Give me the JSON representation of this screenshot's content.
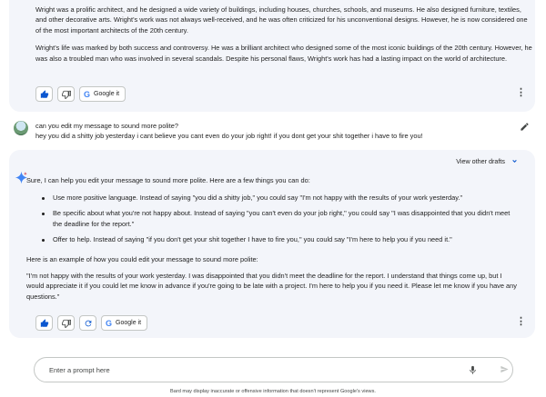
{
  "response1": {
    "paragraph1": "Wright was a prolific architect, and he designed a wide variety of buildings, including houses, churches, schools, and museums. He also designed furniture, textiles, and other decorative arts. Wright's work was not always well-received, and he was often criticized for his unconventional designs. However, he is now considered one of the most important architects of the 20th century.",
    "paragraph2": "Wright's life was marked by both success and controversy. He was a brilliant architect who designed some of the most iconic buildings of the 20th century. However, he was also a troubled man who was involved in several scandals. Despite his personal flaws, Wright's work has had a lasting impact on the world of architecture.",
    "google_it_label": "Google it"
  },
  "user_prompt": {
    "line1": "can you edit my message to sound more polite?",
    "line2": "hey you did a shitty job yesterday i cant believe you cant even do your job right! if you dont get your shit together i have to fire you!"
  },
  "response2": {
    "view_drafts_label": "View other drafts",
    "intro": "Sure, I can help you edit your message to sound more polite. Here are a few things you can do:",
    "bullets": [
      "Use more positive language. Instead of saying \"you did a shitty job,\" you could say \"I'm not happy with the results of your work yesterday.\"",
      "Be specific about what you're not happy about. Instead of saying \"you can't even do your job right,\" you could say \"I was disappointed that you didn't meet the deadline for the report.\"",
      "Offer to help. Instead of saying \"if you don't get your shit together I have to fire you,\" you could say \"I'm here to help you if you need it.\""
    ],
    "example_intro": "Here is an example of how you could edit your message to sound more polite:",
    "example": "\"I'm not happy with the results of your work yesterday. I was disappointed that you didn't meet the deadline for the report. I understand that things come up, but I would appreciate it if you could let me know in advance if you're going to be late with a project. I'm here to help you if you need it. Please let me know if you have any questions.\"",
    "google_it_label": "Google it"
  },
  "input": {
    "placeholder": "Enter a prompt here"
  },
  "disclaimer": "Bard may display inaccurate or offensive information that doesn't represent Google's views.",
  "icons": [
    "thumbs-up-icon",
    "thumbs-down-icon",
    "google-icon",
    "more-vert-icon",
    "edit-icon",
    "sparkle-icon",
    "chevron-down-icon",
    "regenerate-icon",
    "mic-icon",
    "send-icon"
  ],
  "colors": {
    "card_bg": "#f3f5fa",
    "accent": "#0b57d0"
  }
}
